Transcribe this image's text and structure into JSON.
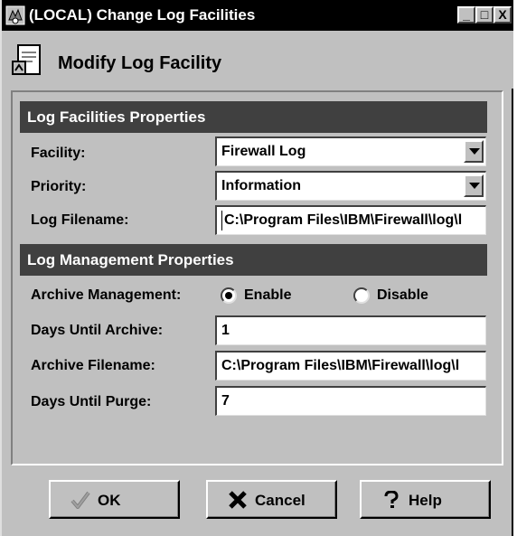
{
  "window": {
    "title": "(LOCAL) Change Log Facilities",
    "minimize_label": "_",
    "maximize_label": "□",
    "close_label": "X"
  },
  "header": {
    "title": "Modify Log Facility"
  },
  "log_facilities_section": {
    "title": "Log Facilities Properties",
    "facility": {
      "label": "Facility:",
      "value": "Firewall Log"
    },
    "priority": {
      "label": "Priority:",
      "value": "Information"
    },
    "log_filename": {
      "label": "Log Filename:",
      "value": "C:\\Program Files\\IBM\\Firewall\\log\\l"
    }
  },
  "log_management_section": {
    "title": "Log Management Properties",
    "archive_management": {
      "label": "Archive Management:",
      "options": [
        {
          "label": "Enable",
          "selected": true
        },
        {
          "label": "Disable",
          "selected": false
        }
      ]
    },
    "days_until_archive": {
      "label": "Days Until Archive:",
      "value": "1"
    },
    "archive_filename": {
      "label": "Archive Filename:",
      "value": "C:\\Program Files\\IBM\\Firewall\\log\\l"
    },
    "days_until_purge": {
      "label": "Days Until Purge:",
      "value": "7"
    }
  },
  "buttons": {
    "ok": {
      "label": "OK",
      "icon": "checkmark-icon"
    },
    "cancel": {
      "label": "Cancel",
      "icon": "x-icon"
    },
    "help": {
      "label": "Help",
      "icon": "question-mark-icon"
    }
  },
  "colors": {
    "section_bar": "#404040",
    "window_bg": "#c0c0c0",
    "field_bg": "#ffffff"
  }
}
